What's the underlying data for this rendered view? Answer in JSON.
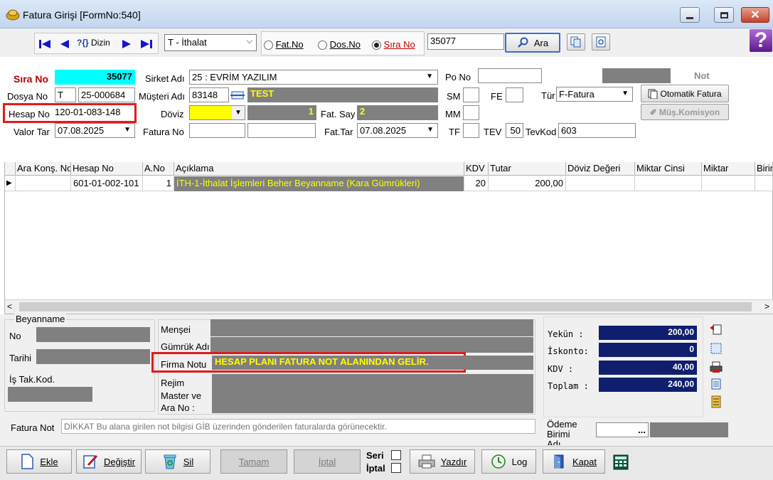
{
  "window": {
    "title": "Fatura Girişi [FormNo:540]",
    "minimize_icon": "minimize-icon",
    "maximize_icon": "maximize-icon",
    "close_icon": "close-icon"
  },
  "toolbar": {
    "dizin_label": "Dizin",
    "dizin_prefix": "?{}",
    "type_select": "T - İthalat",
    "radio_fatno": "Fat.No",
    "radio_dosno": "Dos.No",
    "radio_sirano": "Sıra No",
    "search_value": "35077",
    "search_button": "Ara",
    "help_mark": "?"
  },
  "form": {
    "sira_no_label": "Sıra No",
    "sira_no_value": "35077",
    "sirket_adi_label": "Sirket Adı",
    "sirket_adi_value": "25 : EVRİM YAZILIM",
    "po_no_label": "Po No",
    "not_label": "Not",
    "dosya_no_label": "Dosya No",
    "dosya_no_prefix": "T",
    "dosya_no_value": "25-000684",
    "musteri_adi_label": "Müşteri Adı",
    "musteri_code": "83148",
    "musteri_name": "TEST",
    "sm_label": "SM",
    "fe_label": "FE",
    "tur_label": "Tür",
    "tur_value": "F-Fatura",
    "otomatik_fatura": "Otomatik Fatura",
    "mus_komisyon": "Müş.Komisyon",
    "hesap_no_label": "Hesap No",
    "hesap_no_value": "120-01-083-148",
    "doviz_label": "Döviz",
    "kur_value": "1",
    "fat_say_label": "Fat. Say",
    "fat_say_value": "2",
    "mm_label": "MM",
    "valor_tar_label": "Valor Tar",
    "valor_tar_value": "07.08.2025",
    "fatura_no_label": "Fatura No",
    "fat_tar_label": "Fat.Tar",
    "fat_tar_value": "07.08.2025",
    "tf_label": "TF",
    "tev_label": "TEV",
    "tev_value": "50",
    "tevkod_label": "TevKod",
    "tevkod_value": "603"
  },
  "grid": {
    "columns": [
      "Ara Konş. No",
      "Hesap No",
      "A.No",
      "Açıklama",
      "KDV",
      "Tutar",
      "Döviz Değeri",
      "Miktar Cinsi",
      "Miktar",
      "Birim"
    ],
    "rows": [
      {
        "ara_kons_no": "",
        "hesap_no": "601-01-002-101",
        "a_no": "1",
        "aciklama": "İTH-1-İthalat İşlemleri Beher Beyanname (Kara Gümrükleri)",
        "kdv": "20",
        "tutar": "200,00",
        "doviz_degeri": "",
        "miktar_cinsi": "",
        "miktar": "",
        "birim": ""
      }
    ]
  },
  "beyanname": {
    "group_label": "Beyanname",
    "no_label": "No",
    "tarihi_label": "Tarihi",
    "is_tak_kod_label": "İş Tak.Kod."
  },
  "details": {
    "mensei_label": "Menşei",
    "gumruk_adi_label": "Gümrük Adı",
    "firma_notu_label": "Firma Notu",
    "firma_notu_value": "HESAP PLANI FATURA NOT ALANINDAN GELİR.",
    "rejim_label_1": "Rejim",
    "rejim_label_2": "Master ve",
    "rejim_label_3": "Ara No :"
  },
  "totals": {
    "yekun_label": "Yekün  :",
    "yekun_value": "200,00",
    "iskonto_label": "İskonto:",
    "iskonto_value": "0",
    "kdv_label": "KDV    :",
    "kdv_value": "40,00",
    "toplam_label": "Toplam :",
    "toplam_value": "240,00"
  },
  "fatura_not": {
    "label": "Fatura Not",
    "placeholder": "DİKKAT Bu alana girilen not bilgisi GİB üzerinden gönderilen faturalarda görünecektir.",
    "odeme_birimi_label_1": "Ödeme",
    "odeme_birimi_label_2": "Birimi",
    "odeme_birimi_label_3": "Adı",
    "ellipsis": "..."
  },
  "footer": {
    "ekle": "Ekle",
    "degistir": "Değiştir",
    "sil": "Sil",
    "tamam": "Tamam",
    "iptal": "İptal",
    "seri": "Seri",
    "iptal_check": "İptal",
    "yazdir": "Yazdır",
    "log": "Log",
    "kapat": "Kapat"
  },
  "colors": {
    "sira_no_bg": "#00ffff",
    "doviz_bg": "#ffff00",
    "highlight_red": "#e21b1b",
    "grid_desc_bg": "#808080",
    "grid_desc_fg": "#ffff00",
    "totals_bg": "#0f1f6e"
  }
}
